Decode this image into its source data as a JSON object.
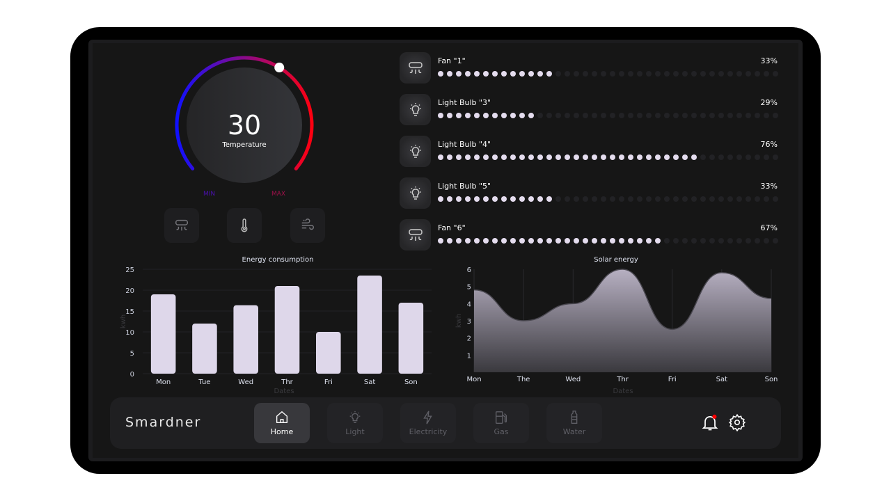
{
  "thermostat": {
    "value": "30",
    "label": "Temperature",
    "min_label": "MIN",
    "max_label": "MAX",
    "level": 0.62,
    "controls": [
      {
        "icon": "air-conditioner-icon"
      },
      {
        "icon": "thermometer-icon"
      },
      {
        "icon": "wind-icon"
      }
    ]
  },
  "devices": [
    {
      "name": "Fan \"1\"",
      "percent": "33%",
      "value": 33,
      "icon": "fan-icon"
    },
    {
      "name": "Light Bulb \"3\"",
      "percent": "29%",
      "value": 29,
      "icon": "light-bulb-icon"
    },
    {
      "name": "Light Bulb \"4\"",
      "percent": "76%",
      "value": 76,
      "icon": "light-bulb-icon"
    },
    {
      "name": "Light Bulb \"5\"",
      "percent": "33%",
      "value": 33,
      "icon": "light-bulb-icon"
    },
    {
      "name": "Fan \"6\"",
      "percent": "67%",
      "value": 67,
      "icon": "fan-icon"
    }
  ],
  "nav": {
    "logo": "Smardner",
    "tabs": [
      {
        "label": "Home",
        "icon": "home-icon",
        "active": true
      },
      {
        "label": "Light",
        "icon": "light-bulb-icon"
      },
      {
        "label": "Electricity",
        "icon": "lightning-icon"
      },
      {
        "label": "Gas",
        "icon": "gas-pump-icon"
      },
      {
        "label": "Water",
        "icon": "water-bottle-icon"
      }
    ],
    "notification_icon": "bell-icon",
    "settings_icon": "gear-icon"
  },
  "colors": {
    "bar": "#ded7ea",
    "notification": "#ff0000",
    "gauge_start": "#1010ff",
    "gauge_end": "#ff0010"
  },
  "chart_data": [
    {
      "type": "bar",
      "title": "Energy consumption",
      "xlabel": "Dates",
      "ylabel": "kwh",
      "categories": [
        "Mon",
        "Tue",
        "Wed",
        "Thr",
        "Fri",
        "Sat",
        "Son"
      ],
      "values": [
        19,
        12,
        16.4,
        21,
        10,
        23.5,
        17
      ],
      "ylim": [
        0,
        25
      ],
      "yticks": [
        0,
        5,
        10,
        15,
        20,
        25
      ],
      "grid": true
    },
    {
      "type": "area",
      "title": "Solar energy",
      "xlabel": "Dates",
      "ylabel": "kwh",
      "categories": [
        "Mon",
        "The",
        "Wed",
        "Thr",
        "Fri",
        "Sat",
        "Son"
      ],
      "values": [
        4.8,
        3.0,
        4.0,
        6.0,
        2.5,
        5.8,
        4.3
      ],
      "ylim": [
        0,
        6
      ],
      "yticks": [
        1,
        2,
        3,
        4,
        5,
        6
      ],
      "grid": true
    }
  ]
}
